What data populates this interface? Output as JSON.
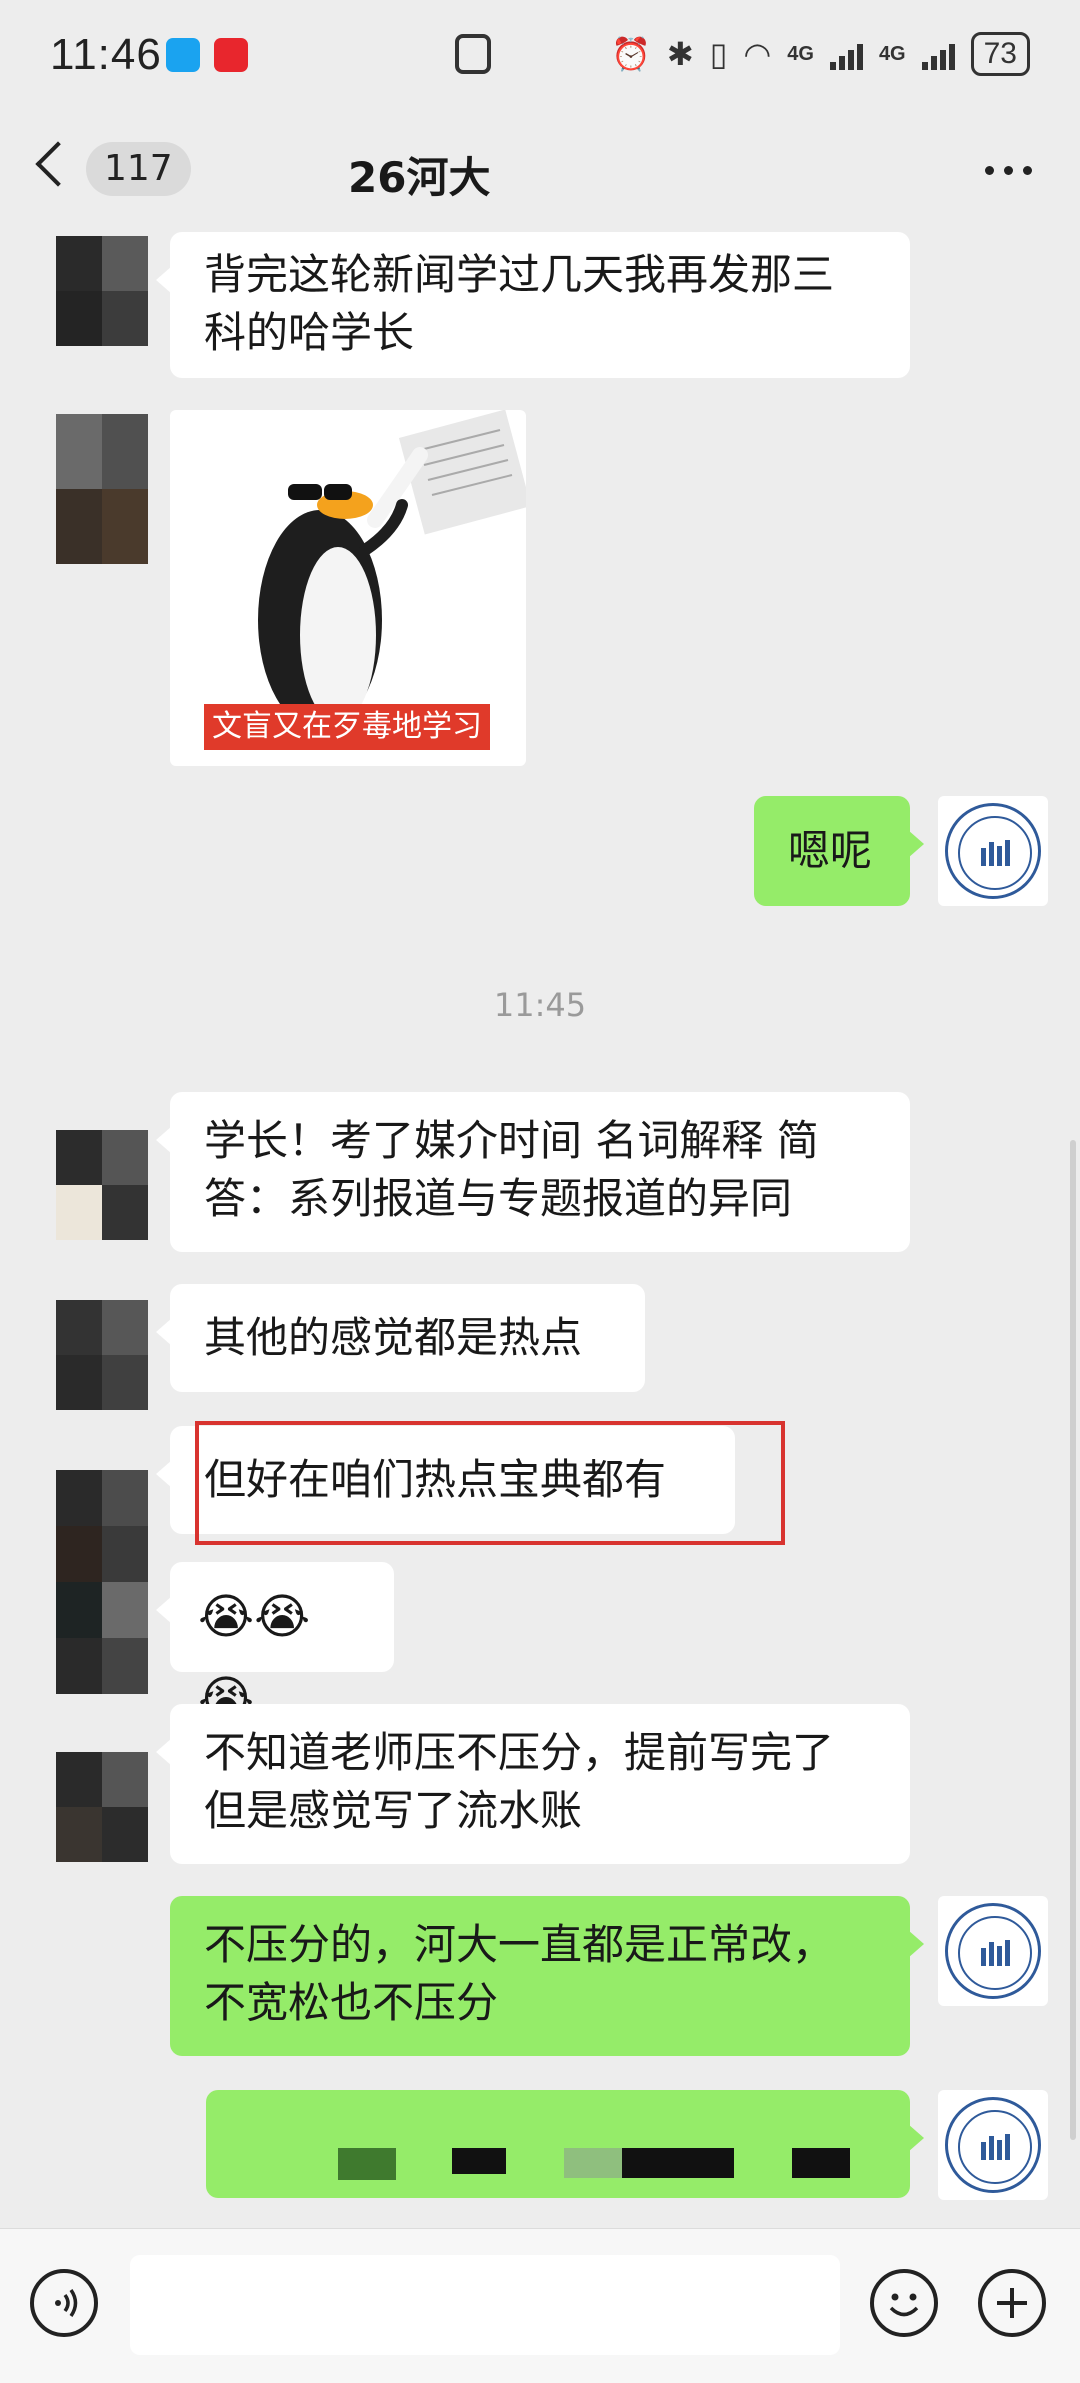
{
  "status_bar": {
    "time": "11:46",
    "signal_1": "4G",
    "signal_2": "4G",
    "battery": "73"
  },
  "header": {
    "unread_count": "117",
    "title": "26河大"
  },
  "messages": [
    {
      "side": "left",
      "type": "text",
      "text_lines": [
        "背完这轮新闻学过几天我再发那三",
        "科的哈学长"
      ]
    },
    {
      "side": "left",
      "type": "sticker",
      "caption": "文盲又在歹毒地学习"
    },
    {
      "side": "right",
      "type": "text",
      "text_lines": [
        "嗯呢"
      ]
    },
    {
      "side": "left",
      "type": "text",
      "text_lines": [
        "学长！考了媒介时间 名词解释 简",
        "答：系列报道与专题报道的异同"
      ]
    },
    {
      "side": "left",
      "type": "text",
      "text_lines": [
        "其他的感觉都是热点"
      ]
    },
    {
      "side": "left",
      "type": "text",
      "text_lines": [
        "但好在咱们热点宝典都有"
      ],
      "highlighted": true
    },
    {
      "side": "left",
      "type": "emoji",
      "text_lines": [
        "😭😭😭"
      ]
    },
    {
      "side": "left",
      "type": "text",
      "text_lines": [
        "不知道老师压不压分，提前写完了",
        "但是感觉写了流水账"
      ]
    },
    {
      "side": "right",
      "type": "text",
      "text_lines": [
        "不压分的，河大一直都是正常改，",
        "不宽松也不压分"
      ]
    },
    {
      "side": "right",
      "type": "redacted",
      "text_lines": []
    }
  ],
  "timestamp": "11:45",
  "colors": {
    "background": "#ededed",
    "bubble_self": "#95ec69",
    "bubble_other": "#ffffff",
    "highlight": "#d8332f"
  },
  "icons": [
    "back-icon",
    "more-icon",
    "voice-icon",
    "emoji-icon",
    "plus-icon",
    "alarm-icon",
    "bluetooth-icon",
    "vibrate-icon",
    "wifi-icon",
    "nfc-icon"
  ]
}
